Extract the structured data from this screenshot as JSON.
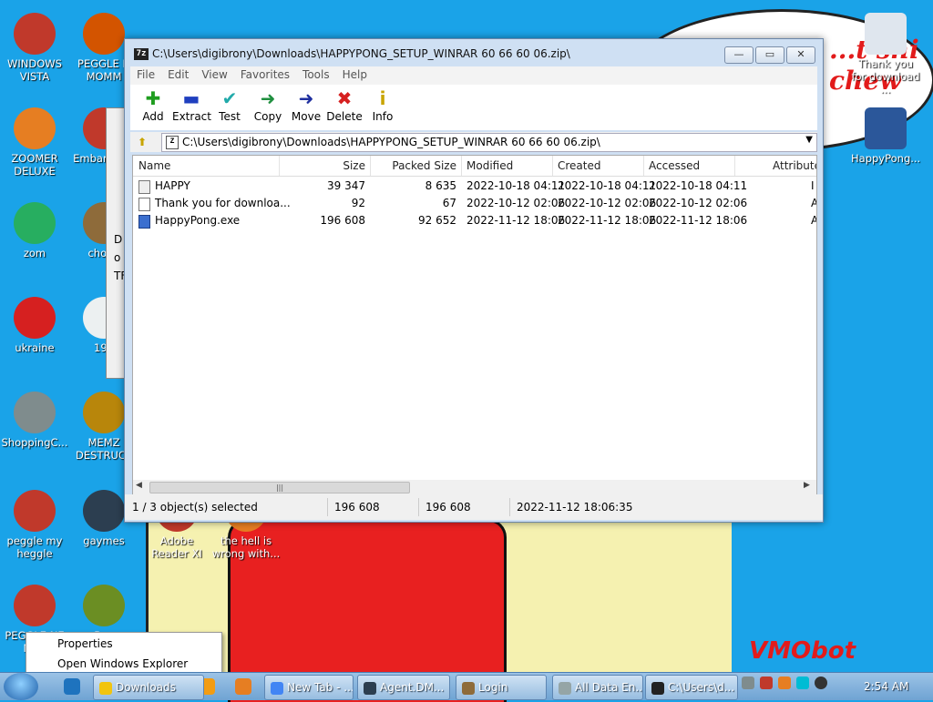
{
  "desktop": {
    "bubble_text": "...t shi\nchew",
    "watermark": "VMObot",
    "icons": [
      {
        "label": "WINDOWS VISTA",
        "color": "#c0392b"
      },
      {
        "label": "PEGGLE N MOMM",
        "color": "#d35400"
      },
      {
        "label": "ZOOMER DELUXE",
        "color": "#e67e22"
      },
      {
        "label": "Embar Dev-",
        "color": "#c0392b"
      },
      {
        "label": "zom",
        "color": "#27ae60"
      },
      {
        "label": "chomi",
        "color": "#8e6b3a"
      },
      {
        "label": "ukraine",
        "color": "#d62020"
      },
      {
        "label": "198",
        "color": "#ecf0f1"
      },
      {
        "label": "ShoppingC...",
        "color": "#7f8c8d"
      },
      {
        "label": "MEMZ DESTRUCT",
        "color": "#b8860b"
      },
      {
        "label": "peggle my heggle",
        "color": "#c0392b"
      },
      {
        "label": "gaymes",
        "color": "#2c3e50"
      },
      {
        "label": "Adobe Reader XI",
        "color": "#c0392b"
      },
      {
        "label": "the hell is wrong with...",
        "color": "#e67e22"
      },
      {
        "label": "PEGGLE NE NEO",
        "color": "#c0392b"
      },
      {
        "label": "Box",
        "color": "#6b8e23"
      },
      {
        "label": "Thank you for download ...",
        "color": "#dfe6ee"
      },
      {
        "label": "HappyPong...",
        "color": "#2b579a"
      }
    ],
    "back_window_text": [
      "D",
      "o",
      "TF"
    ]
  },
  "window": {
    "title": "C:\\Users\\digibrony\\Downloads\\HAPPYPONG_SETUP_WINRAR 60 66 60 06.zip\\",
    "app_icon": "7z",
    "buttons": {
      "minimize": "—",
      "maximize": "▭",
      "close": "✕"
    },
    "menu": [
      "File",
      "Edit",
      "View",
      "Favorites",
      "Tools",
      "Help"
    ],
    "toolbar": [
      {
        "label": "Add",
        "icon": "plus-icon",
        "glyph": "✚",
        "color": "#1f9d1f"
      },
      {
        "label": "Extract",
        "icon": "minus-icon",
        "glyph": "▬",
        "color": "#1f3fbf"
      },
      {
        "label": "Test",
        "icon": "check-icon",
        "glyph": "✔",
        "color": "#22aaaa"
      },
      {
        "label": "Copy",
        "icon": "arrow-right-icon",
        "glyph": "➜",
        "color": "#1f8f3f"
      },
      {
        "label": "Move",
        "icon": "arrow-right-icon",
        "glyph": "➜",
        "color": "#1f2f9f"
      },
      {
        "label": "Delete",
        "icon": "x-icon",
        "glyph": "✖",
        "color": "#d62020"
      },
      {
        "label": "Info",
        "icon": "info-icon",
        "glyph": "i",
        "color": "#c8a400"
      }
    ],
    "address": "C:\\Users\\digibrony\\Downloads\\HAPPYPONG_SETUP_WINRAR 60 66 60 06.zip\\",
    "columns": [
      "Name",
      "Size",
      "Packed Size",
      "Modified",
      "Created",
      "Accessed",
      "Attribute"
    ],
    "rows": [
      {
        "name": "HAPPY",
        "size": "39 347",
        "packed": "8 635",
        "modified": "2022-10-18 04:11",
        "created": "2022-10-18 04:11",
        "accessed": "2022-10-18 04:11",
        "attr": "I",
        "kind": "file"
      },
      {
        "name": "Thank you for downloa...",
        "size": "92",
        "packed": "67",
        "modified": "2022-10-12 02:06",
        "created": "2022-10-12 02:06",
        "accessed": "2022-10-12 02:06",
        "attr": "A",
        "kind": "doc"
      },
      {
        "name": "HappyPong.exe",
        "size": "196 608",
        "packed": "92 652",
        "modified": "2022-11-12 18:06",
        "created": "2022-11-12 18:06",
        "accessed": "2022-11-12 18:06",
        "attr": "A",
        "kind": "exe"
      }
    ],
    "status": {
      "selection": "1 / 3 object(s) selected",
      "size": "196 608",
      "packed": "196 608",
      "modified": "2022-11-12 18:06:35"
    }
  },
  "context_menu": [
    "Properties",
    "Open Windows Explorer"
  ],
  "taskbar": {
    "buttons": [
      {
        "label": "Downloads",
        "color": "#f1c40f"
      },
      {
        "label": "New Tab - ...",
        "color": "#4285f4"
      },
      {
        "label": "Agent.DM...",
        "color": "#2c3e50"
      },
      {
        "label": "Login",
        "color": "#8e6b3a"
      },
      {
        "label": "All Data En...",
        "color": "#95a5a6"
      },
      {
        "label": "C:\\Users\\d...",
        "color": "#222222"
      }
    ],
    "clock": "2:54 AM"
  }
}
